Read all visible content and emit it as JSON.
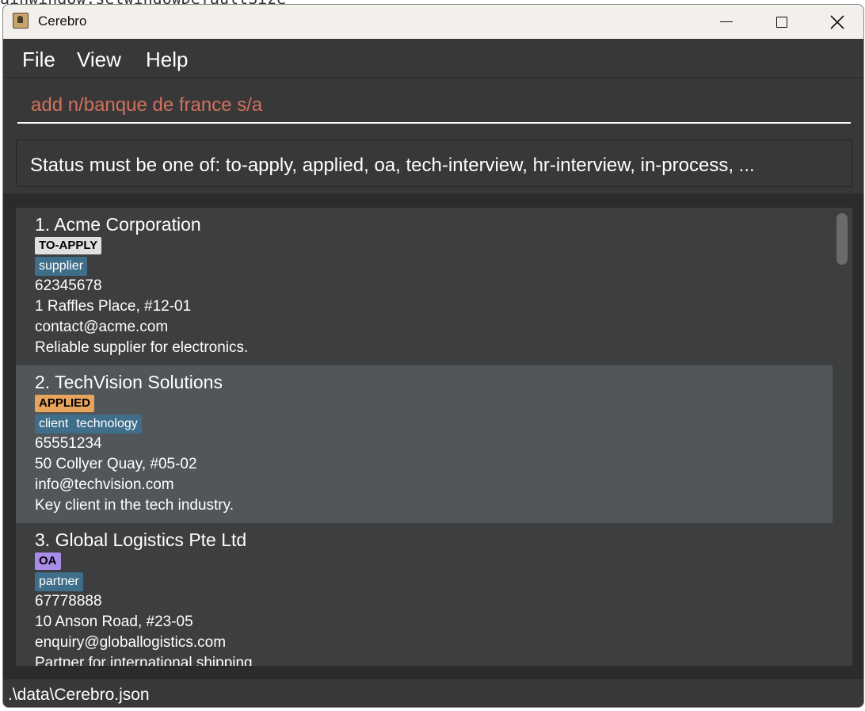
{
  "background_text": "ainwindow.setwindowDefaultSize",
  "window": {
    "title": "Cerebro",
    "controls": {
      "minimize": "minimize",
      "maximize": "maximize",
      "close": "close"
    }
  },
  "menu": {
    "file": "File",
    "view": "View",
    "help": "Help"
  },
  "command": {
    "value": "add n/banque de france s/a"
  },
  "result": {
    "text": "Status must be one of: to-apply, applied, oa, tech-interview, hr-interview, in-process, ..."
  },
  "companies": [
    {
      "title": "1. Acme Corporation",
      "status": "TO-APPLY",
      "status_color": "#e0e0e0",
      "tags": [
        "supplier"
      ],
      "phone": "62345678",
      "address": "1 Raffles Place, #12-01",
      "email": "contact@acme.com",
      "remark": "Reliable supplier for electronics."
    },
    {
      "title": "2. TechVision Solutions",
      "status": "APPLIED",
      "status_color": "#e8a35c",
      "tags": [
        "client",
        "technology"
      ],
      "phone": "65551234",
      "address": "50 Collyer Quay, #05-02",
      "email": "info@techvision.com",
      "remark": "Key client in the tech industry."
    },
    {
      "title": "3. Global Logistics Pte Ltd",
      "status": "OA",
      "status_color": "#a98be8",
      "tags": [
        "partner"
      ],
      "phone": "67778888",
      "address": "10 Anson Road, #23-05",
      "email": "enquiry@globallogistics.com",
      "remark": "Partner for international shipping."
    }
  ],
  "statusbar": {
    "path": ".\\data\\Cerebro.json"
  }
}
